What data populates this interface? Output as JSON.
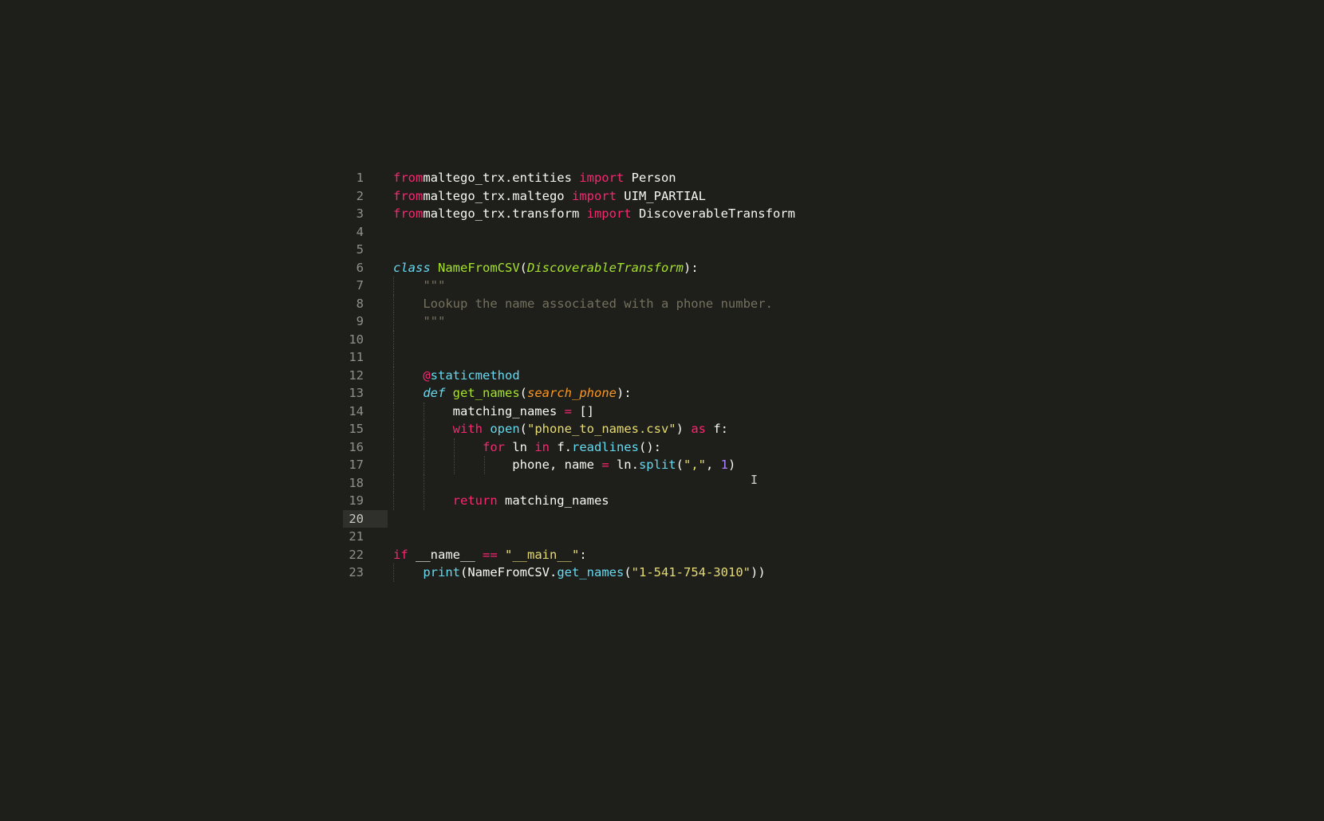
{
  "editor": {
    "current_line": 20,
    "lines": [
      {
        "n": "1",
        "indent": 0,
        "tokens": [
          [
            "kw",
            "from"
          ],
          [
            "",
            "maltego_trx.entities "
          ],
          [
            "kw",
            "import"
          ],
          [
            "",
            " Person"
          ]
        ]
      },
      {
        "n": "2",
        "indent": 0,
        "tokens": [
          [
            "kw",
            "from"
          ],
          [
            "",
            "maltego_trx.maltego "
          ],
          [
            "kw",
            "import"
          ],
          [
            "",
            " UIM_PARTIAL"
          ]
        ]
      },
      {
        "n": "3",
        "indent": 0,
        "tokens": [
          [
            "kw",
            "from"
          ],
          [
            "",
            "maltego_trx.transform "
          ],
          [
            "kw",
            "import"
          ],
          [
            "",
            " DiscoverableTransform"
          ]
        ]
      },
      {
        "n": "4",
        "indent": 0,
        "tokens": []
      },
      {
        "n": "5",
        "indent": 0,
        "tokens": []
      },
      {
        "n": "6",
        "indent": 0,
        "tokens": [
          [
            "st",
            "class"
          ],
          [
            "",
            " "
          ],
          [
            "cls",
            "NameFromCSV"
          ],
          [
            "",
            "("
          ],
          [
            "inh",
            "DiscoverableTransform"
          ],
          [
            "",
            "):"
          ]
        ]
      },
      {
        "n": "7",
        "indent": 1,
        "tokens": [
          [
            "cmt",
            "    \"\"\""
          ]
        ]
      },
      {
        "n": "8",
        "indent": 1,
        "tokens": [
          [
            "cmt",
            "    Lookup the name associated with a phone number."
          ]
        ]
      },
      {
        "n": "9",
        "indent": 1,
        "tokens": [
          [
            "cmt",
            "    \"\"\""
          ]
        ]
      },
      {
        "n": "10",
        "indent": 1,
        "tokens": []
      },
      {
        "n": "11",
        "indent": 1,
        "tokens": []
      },
      {
        "n": "12",
        "indent": 1,
        "tokens": [
          [
            "",
            "    "
          ],
          [
            "op",
            "@"
          ],
          [
            "bi",
            "staticmethod"
          ]
        ]
      },
      {
        "n": "13",
        "indent": 1,
        "tokens": [
          [
            "",
            "    "
          ],
          [
            "st",
            "def"
          ],
          [
            "",
            " "
          ],
          [
            "fn",
            "get_names"
          ],
          [
            "",
            "("
          ],
          [
            "prm",
            "search_phone"
          ],
          [
            "",
            "):"
          ]
        ]
      },
      {
        "n": "14",
        "indent": 2,
        "tokens": [
          [
            "",
            "        matching_names "
          ],
          [
            "op",
            "="
          ],
          [
            "",
            " []"
          ]
        ]
      },
      {
        "n": "15",
        "indent": 2,
        "tokens": [
          [
            "",
            "        "
          ],
          [
            "kw",
            "with"
          ],
          [
            "",
            " "
          ],
          [
            "bi",
            "open"
          ],
          [
            "",
            "("
          ],
          [
            "str",
            "\"phone_to_names.csv\""
          ],
          [
            "",
            ") "
          ],
          [
            "kw",
            "as"
          ],
          [
            "",
            " f:"
          ]
        ]
      },
      {
        "n": "16",
        "indent": 3,
        "tokens": [
          [
            "",
            "            "
          ],
          [
            "kw",
            "for"
          ],
          [
            "",
            " ln "
          ],
          [
            "kw",
            "in"
          ],
          [
            "",
            " f."
          ],
          [
            "bi",
            "readlines"
          ],
          [
            "",
            "():"
          ]
        ]
      },
      {
        "n": "17",
        "indent": 4,
        "tokens": [
          [
            "",
            "                phone, name "
          ],
          [
            "op",
            "="
          ],
          [
            "",
            " ln."
          ],
          [
            "bi",
            "split"
          ],
          [
            "",
            "("
          ],
          [
            "str",
            "\",\""
          ],
          [
            "",
            ", "
          ],
          [
            "num",
            "1"
          ],
          [
            "",
            ")"
          ]
        ]
      },
      {
        "n": "18",
        "indent": 2,
        "tokens": []
      },
      {
        "n": "19",
        "indent": 2,
        "tokens": [
          [
            "",
            "        "
          ],
          [
            "kw",
            "return"
          ],
          [
            "",
            " matching_names"
          ]
        ]
      },
      {
        "n": "20",
        "indent": 0,
        "tokens": []
      },
      {
        "n": "21",
        "indent": 0,
        "tokens": []
      },
      {
        "n": "22",
        "indent": 0,
        "tokens": [
          [
            "kw",
            "if"
          ],
          [
            "",
            " __name__ "
          ],
          [
            "op",
            "=="
          ],
          [
            "",
            " "
          ],
          [
            "str",
            "\"__main__\""
          ],
          [
            "",
            ":"
          ]
        ]
      },
      {
        "n": "23",
        "indent": 1,
        "tokens": [
          [
            "",
            "    "
          ],
          [
            "bi",
            "print"
          ],
          [
            "",
            "(NameFromCSV."
          ],
          [
            "bi",
            "get_names"
          ],
          [
            "",
            "("
          ],
          [
            "str",
            "\"1-541-754-3010\""
          ],
          [
            "",
            "))"
          ]
        ]
      }
    ]
  },
  "cursor_glyph": "I"
}
